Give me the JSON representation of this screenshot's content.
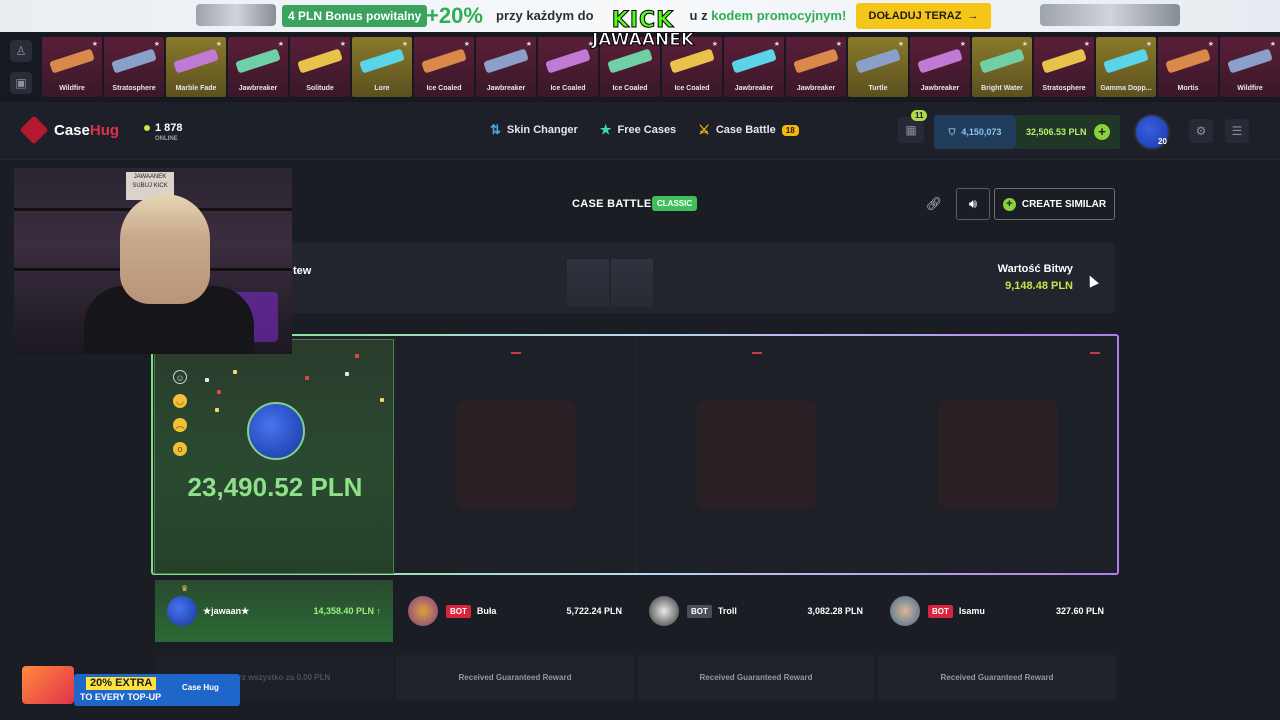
{
  "promo": {
    "bonus": "4 PLN Bonus powitalny",
    "percent": "+20%",
    "message_before": "przy każdym do",
    "message_after": "u z",
    "code_text": "kodem promocyjnym!",
    "topup_label": "DOŁADUJ TERAZ"
  },
  "overlay": {
    "line1": "KICK",
    "line2": "JAWAANEK"
  },
  "feed": {
    "items": [
      {
        "label": "Wildfire",
        "rarity": "covert"
      },
      {
        "label": "Stratosphere",
        "rarity": "covert"
      },
      {
        "label": "Marble Fade",
        "rarity": "gold"
      },
      {
        "label": "Jawbreaker",
        "rarity": "covert"
      },
      {
        "label": "Solitude",
        "rarity": "covert"
      },
      {
        "label": "Lore",
        "rarity": "gold"
      },
      {
        "label": "Ice Coaled",
        "rarity": "covert"
      },
      {
        "label": "Jawbreaker",
        "rarity": "covert"
      },
      {
        "label": "Ice Coaled",
        "rarity": "covert"
      },
      {
        "label": "Ice Coaled",
        "rarity": "covert"
      },
      {
        "label": "Ice Coaled",
        "rarity": "covert"
      },
      {
        "label": "Jawbreaker",
        "rarity": "covert"
      },
      {
        "label": "Jawbreaker",
        "rarity": "covert"
      },
      {
        "label": "Turtle",
        "rarity": "gold"
      },
      {
        "label": "Jawbreaker",
        "rarity": "covert"
      },
      {
        "label": "Bright Water",
        "rarity": "gold"
      },
      {
        "label": "Stratosphere",
        "rarity": "covert"
      },
      {
        "label": "Gamma Dopp...",
        "rarity": "gold"
      },
      {
        "label": "Mortis",
        "rarity": "covert"
      },
      {
        "label": "Wildfire",
        "rarity": "covert"
      }
    ]
  },
  "header": {
    "logo_case": "Case",
    "logo_hug": "Hug",
    "online_count": "1 878",
    "online_label": "ONLINE",
    "nav": {
      "skin_changer": "Skin Changer",
      "free_cases": "Free Cases",
      "case_battle": "Case Battle",
      "case_battle_badge": "18"
    },
    "gift_badge": "11",
    "coins": "4,150,073",
    "balance": "32,506.53 PLN",
    "avatar_level": "20"
  },
  "battle": {
    "title": "CASE BATTLE",
    "mode": "CLASSIC",
    "create_label": "CREATE SIMILAR",
    "rounds_label": "tew",
    "value_label": "Wartość Bitwy",
    "value": "9,148.48 PLN",
    "winner_amount": "23,490.52 PLN"
  },
  "players": [
    {
      "name": "★jawaan★",
      "amount": "14,358.40 PLN ↑",
      "bot": false
    },
    {
      "name": "Buła",
      "amount": "5,722.24 PLN",
      "bot": true,
      "bot_label": "BOT"
    },
    {
      "name": "Troll",
      "amount": "3,082.28 PLN",
      "bot": true,
      "bot_label": "BOT"
    },
    {
      "name": "Isamu",
      "amount": "327.60 PLN",
      "bot": true,
      "bot_label": "BOT"
    }
  ],
  "rewards": {
    "first": "Zabierz wszystko za 0.00 PLN",
    "guaranteed": "Received Guaranteed Reward"
  },
  "ad": {
    "line1": "20% EXTRA",
    "line2": "TO EVERY TOP-UP",
    "logo": "Case Hug"
  },
  "cam": {
    "poster": "JAWAANEK SUBUJ KICK"
  },
  "colors": {
    "accent_green": "#8ee08a",
    "brand_red": "#e2324a",
    "bot_red": "#d8243d",
    "gold": "#f5c518"
  }
}
